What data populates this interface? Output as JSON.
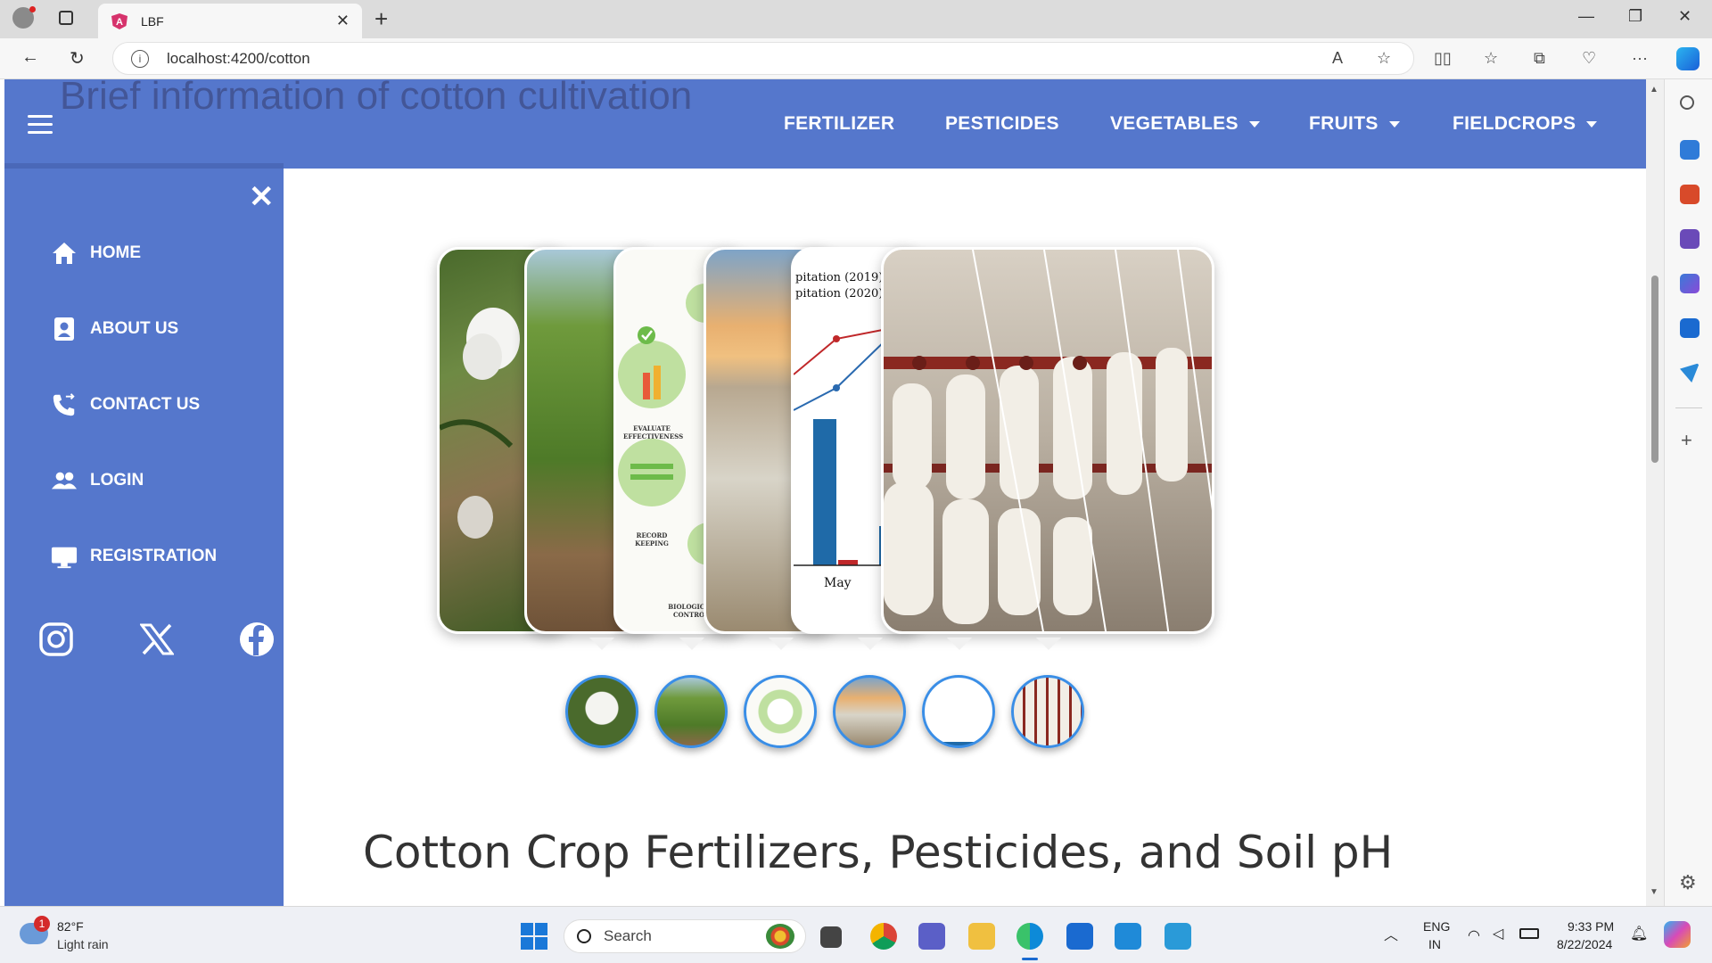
{
  "browser": {
    "tab_title": "LBF",
    "url": "localhost:4200/cotton"
  },
  "page": {
    "ghost_title": "Brief information of cotton cultivation",
    "nav": [
      {
        "label": "FERTILIZER",
        "dropdown": false
      },
      {
        "label": "PESTICIDES",
        "dropdown": false
      },
      {
        "label": "VEGETABLES",
        "dropdown": true
      },
      {
        "label": "FRUITS",
        "dropdown": true
      },
      {
        "label": "FIELDCROPS",
        "dropdown": true
      }
    ],
    "sidebar": [
      {
        "label": "HOME",
        "icon": "home-icon"
      },
      {
        "label": "ABOUT US",
        "icon": "contact-card-icon"
      },
      {
        "label": "CONTACT US",
        "icon": "phone-icon"
      },
      {
        "label": "LOGIN",
        "icon": "users-icon"
      },
      {
        "label": "REGISTRATION",
        "icon": "monitor-icon"
      }
    ],
    "carousel_chart_text": {
      "legend1": "pitation (2019)",
      "legend2": "pitation (2020)",
      "xlabel": "May"
    },
    "carousel_infographic_text": {
      "label1": "EVALUATE EFFECTIVENESS",
      "label2": "RECORD KEEPING",
      "label3": "BIOLOGICAL CONTROL"
    },
    "heading": "Cotton Crop Fertilizers, Pesticides, and Soil pH"
  },
  "taskbar": {
    "weather_temp": "82°F",
    "weather_desc": "Light rain",
    "weather_badge": "1",
    "search_placeholder": "Search",
    "lang_top": "ENG",
    "lang_bottom": "IN",
    "time": "9:33 PM",
    "date": "8/22/2024"
  },
  "colors": {
    "nav_bg": "#5577cc",
    "thumb_ring": "#3a8ee6"
  }
}
